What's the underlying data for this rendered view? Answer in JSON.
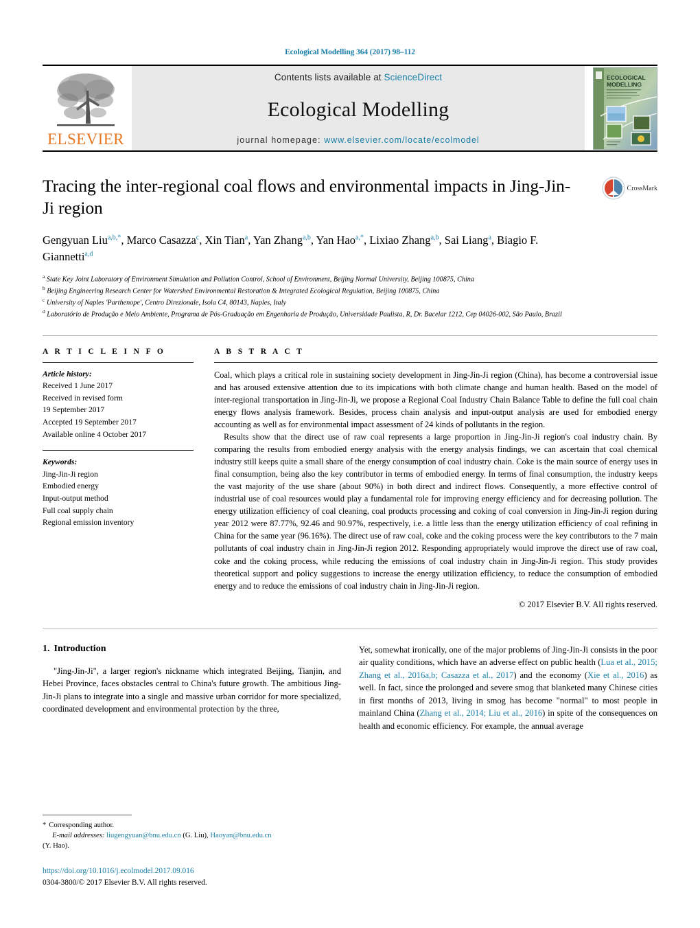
{
  "running_head": "Ecological Modelling 364 (2017) 98–112",
  "masthead": {
    "publisher_name": "ELSEVIER",
    "contents_prefix": "Contents lists available at ",
    "contents_link": "ScienceDirect",
    "journal_name": "Ecological Modelling",
    "homepage_prefix": "journal homepage: ",
    "homepage_url": "www.elsevier.com/locate/ecolmodel",
    "cover_title_line1": "ECOLOGICAL",
    "cover_title_line2": "MODELLING"
  },
  "crossmark": {
    "label": "CrossMark"
  },
  "article": {
    "title": "Tracing the inter-regional coal flows and environmental impacts in Jing-Jin-Ji region",
    "authors_html": "Gengyuan Liu<sup>a,b,*</sup>, Marco Casazza<sup>c</sup>, Xin Tian<sup>a</sup>, Yan Zhang<sup>a,b</sup>, Yan Hao<sup>a,*</sup>, Lixiao Zhang<sup>a,b</sup>, Sai Liang<sup>a</sup>, Biagio F. Giannetti<sup>a,d</sup>",
    "affiliations": [
      {
        "mark": "a",
        "text": "State Key Joint Laboratory of Environment Simulation and Pollution Control, School of Environment, Beijing Normal University, Beijing 100875, China"
      },
      {
        "mark": "b",
        "text": "Beijing Engineering Research Center for Watershed Environmental Restoration & Integrated Ecological Regulation, Beijing 100875, China"
      },
      {
        "mark": "c",
        "text": "University of Naples 'Parthenope', Centro Direzionale, Isola C4, 80143, Naples, Italy"
      },
      {
        "mark": "d",
        "text": "Laboratório de Produção e Meio Ambiente, Programa de Pós-Graduação em Engenharia de Produção, Universidade Paulista, R, Dr. Bacelar 1212, Cep 04026-002, São Paulo, Brazil"
      }
    ]
  },
  "article_info": {
    "heading": "A R T I C L E   I N F O",
    "history_label": "Article history:",
    "history": [
      "Received 1 June 2017",
      "Received in revised form",
      "19 September 2017",
      "Accepted 19 September 2017",
      "Available online 4 October 2017"
    ],
    "keywords_label": "Keywords:",
    "keywords": [
      "Jing-Jin-Ji region",
      "Embodied energy",
      "Input-output method",
      "Full coal supply chain",
      "Regional emission inventory"
    ]
  },
  "abstract": {
    "heading": "A B S T R A C T",
    "paragraph1": "Coal, which plays a critical role in sustaining society development in Jing-Jin-Ji region (China), has become a controversial issue and has aroused extensive attention due to its impications with both climate change and human health. Based on the model of inter-regional transportation in Jing-Jin-Ji, we propose a Regional Coal Industry Chain Balance Table to define the full coal chain energy flows analysis framework. Besides, process chain analysis and input-output analysis are used for embodied energy accounting as well as for environmental impact assessment of 24 kinds of pollutants in the region.",
    "paragraph2": "Results show that the direct use of raw coal represents a large proportion in Jing-Jin-Ji region's coal industry chain. By comparing the results from embodied energy analysis with the energy analysis findings, we can ascertain that coal chemical industry still keeps quite a small share of the energy consumption of coal industry chain. Coke is the main source of energy uses in final consumption, being also the key contributor in terms of embodied energy. In terms of final consumption, the industry keeps the vast majority of the use share (about 90%) in both direct and indirect flows. Consequently, a more effective control of industrial use of coal resources would play a fundamental role for improving energy efficiency and for decreasing pollution. The energy utilization efficiency of coal cleaning, coal products processing and coking of coal conversion in Jing-Jin-Ji region during year 2012 were 87.77%, 92.46 and 90.97%, respectively, i.e. a little less than the energy utilization efficiency of coal refining in China for the same year (96.16%). The direct use of raw coal, coke and the coking process were the key contributors to the 7 main pollutants of coal industry chain in Jing-Jin-Ji region 2012. Responding appropriately would improve the direct use of raw coal, coke and the coking process, while reducing the emissions of coal industry chain in Jing-Jin-Ji region. This study provides theoretical support and policy suggestions to increase the energy utilization efficiency, to reduce the consumption of embodied energy and to reduce the emissions of coal industry chain in Jing-Jin-Ji region.",
    "copyright": "© 2017 Elsevier B.V. All rights reserved."
  },
  "body": {
    "section_number": "1.",
    "section_title": "Introduction",
    "left_paragraph": "\"Jing-Jin-Ji\", a larger region's nickname which integrated Beijing, Tianjin, and Hebei Province, faces obstacles central to China's future growth. The ambitious Jing-Jin-Ji plans to integrate into a single and massive urban corridor for more specialized, coordinated development and environmental protection by the three,",
    "right_paragraph_parts": {
      "t1": "Yet, somewhat ironically, one of the major problems of Jing-Jin-Ji consists in the poor air quality conditions, which have an adverse effect on public health (",
      "ref1": "Lua et al., 2015; Zhang et al., 2016a,b; Casazza et al., 2017",
      "t2": ") and the economy (",
      "ref2": "Xie et al., 2016",
      "t3": ") as well. In fact, since the prolonged and severe smog that blanketed many Chinese cities in first months of 2013, living in smog has become \"normal\" to most people in mainland China (",
      "ref3": "Zhang et al., 2014; Liu et al., 2016",
      "t4": ") in spite of the consequences on health and economic efficiency. For example, the annual average"
    }
  },
  "footnote": {
    "star": "*",
    "corresponding": "Corresponding author.",
    "email_label": "E-mail addresses:",
    "email1": "liugengyuan@bnu.edu.cn",
    "email1_name": " (G. Liu), ",
    "email2": "Haoyan@bnu.edu.cn",
    "email2_name": "(Y. Hao).",
    "doi": "https://doi.org/10.1016/j.ecolmodel.2017.09.016",
    "issn_line": "0304-3800/© 2017 Elsevier B.V. All rights reserved."
  },
  "colors": {
    "link": "#1a7fa8",
    "elsevier_orange": "#e87722",
    "masthead_bg": "#e9e9e9"
  }
}
